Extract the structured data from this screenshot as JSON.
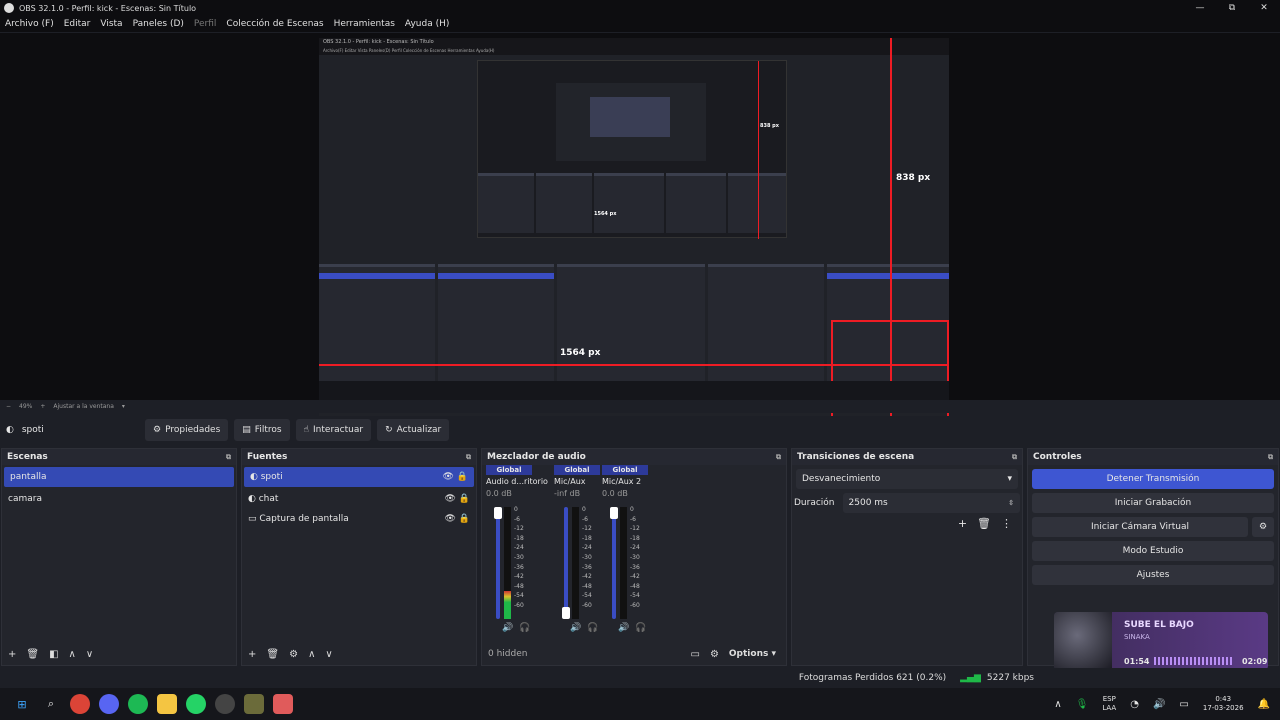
{
  "window": {
    "title": "OBS 32.1.0 - Perfil: kick - Escenas: Sin Título",
    "min": "—",
    "max": "⧉",
    "close": "✕"
  },
  "menu": [
    "Archivo (F)",
    "Editar",
    "Vista",
    "Paneles (D)",
    "Perfil",
    "Colección de Escenas",
    "Herramientas",
    "Ayuda (H)"
  ],
  "preview": {
    "label_right": "838 px",
    "label_bottom": "1564 px",
    "inner_title": "OBS 32.1.0 - Perfil: kick - Escenas: Sin Título",
    "inner_label_right": "838 px",
    "inner_label_bottom": "1564 px"
  },
  "zoombar": {
    "zoom": "49%",
    "fit": "Ajustar a la ventana"
  },
  "source_toolbar": {
    "source_name": "spoti",
    "buttons": [
      "Propiedades",
      "Filtros",
      "Interactuar",
      "Actualizar"
    ]
  },
  "scenes": {
    "title": "Escenas",
    "items": [
      "pantalla",
      "camara"
    ],
    "selected": 0
  },
  "sources": {
    "title": "Fuentes",
    "items": [
      "spoti",
      "chat",
      "Captura de pantalla"
    ],
    "selected": 0
  },
  "mixer": {
    "title": "Mezclador de audio",
    "channels": [
      {
        "scope": "Global",
        "name": "Audio d...ritorio",
        "db": "0.0 dB",
        "level": 0.25
      },
      {
        "scope": "Global",
        "name": "Mic/Aux",
        "db": "-inf dB",
        "level": 0.0
      },
      {
        "scope": "Global",
        "name": "Mic/Aux 2",
        "db": "0.0 dB",
        "level": 0.0
      }
    ],
    "scale": [
      "0",
      "-6",
      "-12",
      "-18",
      "-24",
      "-30",
      "-36",
      "-42",
      "-48",
      "-54",
      "-60"
    ],
    "hidden": "0 hidden",
    "options": "Options"
  },
  "transitions": {
    "title": "Transiciones de escena",
    "selected": "Desvanecimiento",
    "duration_label": "Duración",
    "duration_value": "2500 ms"
  },
  "controls": {
    "title": "Controles",
    "buttons": [
      "Detener Transmisión",
      "Iniciar Grabación",
      "Iniciar Cámara Virtual",
      "Modo Estudio",
      "Ajustes"
    ]
  },
  "spotify": {
    "song": "SUBE EL BAJO",
    "artist": "SINAKA",
    "elapsed": "01:54",
    "total": "02:09"
  },
  "status": {
    "dropped": "Fotogramas Perdidos 621 (0.2%)",
    "bitrate": "5227 kbps"
  },
  "taskbar": {
    "lang1": "ESP",
    "lang2": "LAA",
    "time": "0:43",
    "date": "17-03-2026"
  },
  "colors": {
    "accent": "#3e56d2",
    "selection": "#344ab4",
    "red_guides": "#ee1c24"
  }
}
